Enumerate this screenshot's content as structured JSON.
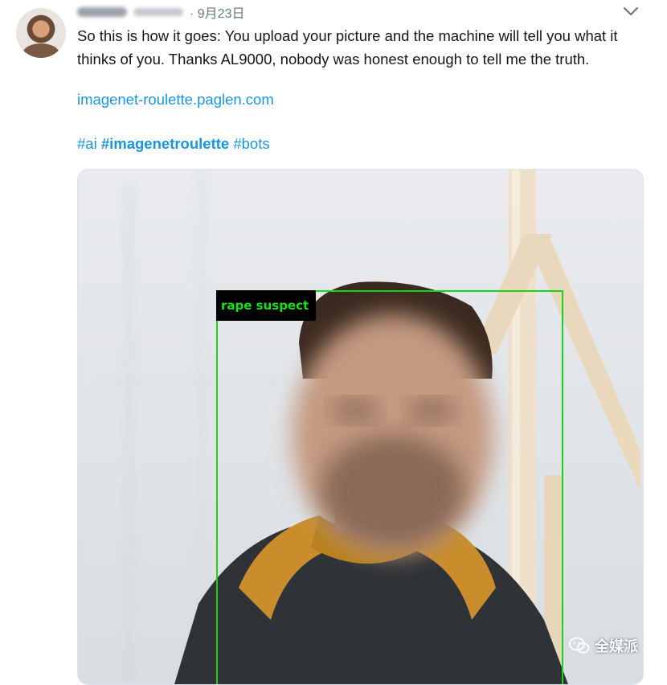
{
  "tweet": {
    "date": "· 9月23日",
    "text": "So this is how it goes: You upload your picture and the machine will tell you what it thinks of you. Thanks AL9000, nobody was honest enough to tell me the truth.",
    "link": "imagenet-roulette.paglen.com",
    "hashtags": [
      {
        "text": "#ai",
        "bold": false
      },
      {
        "text": "#imagenetroulette",
        "bold": true
      },
      {
        "text": "#bots",
        "bold": false
      }
    ]
  },
  "media": {
    "label": "rape suspect",
    "label_color": "#19e019",
    "box_color": "#17d417"
  },
  "watermark": {
    "text": "全媒派",
    "icon": "wechat-icon"
  },
  "colors": {
    "link": "#1b95e0",
    "text": "#14171a",
    "meta": "#657786"
  }
}
